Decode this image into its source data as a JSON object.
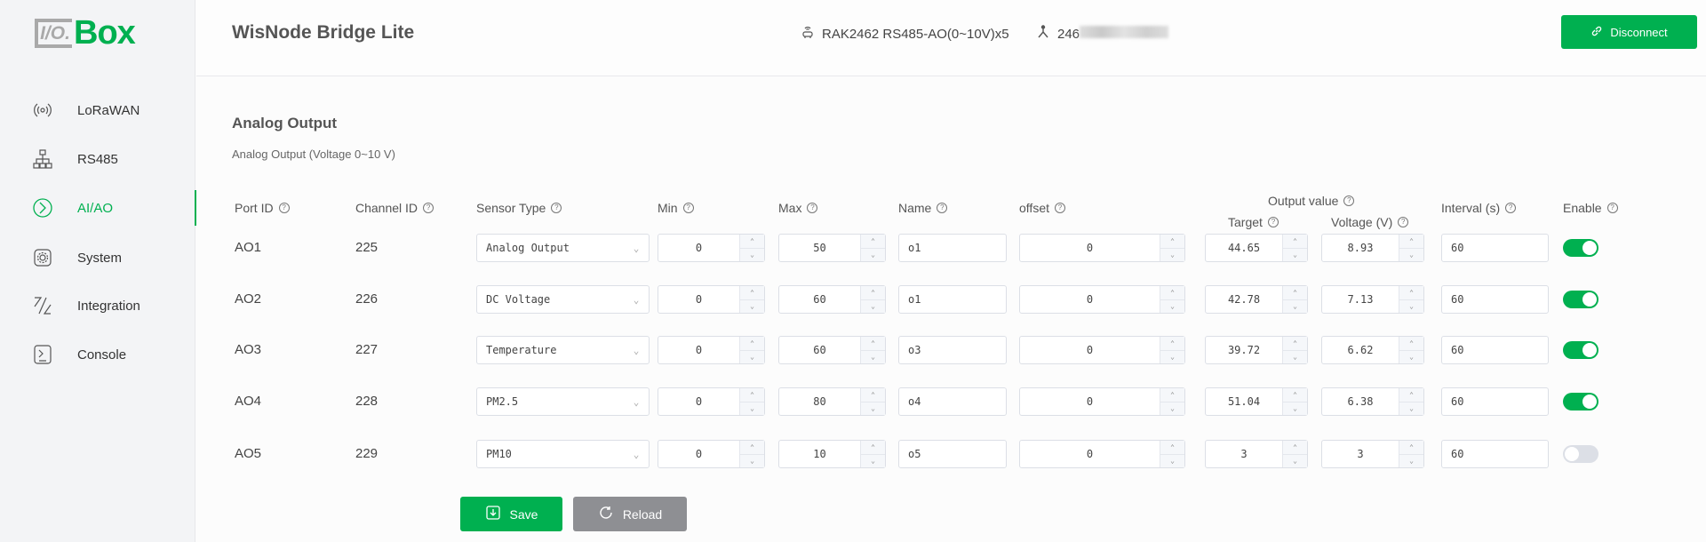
{
  "logo": {
    "io": "I/O.",
    "box": "Box"
  },
  "sidebar": {
    "items": [
      {
        "label": "LoRaWAN",
        "icon": "signal-icon"
      },
      {
        "label": "RS485",
        "icon": "network-icon"
      },
      {
        "label": "AI/AO",
        "icon": "aiao-icon",
        "active": true
      },
      {
        "label": "System",
        "icon": "gear-icon"
      },
      {
        "label": "Integration",
        "icon": "integration-icon"
      },
      {
        "label": "Console",
        "icon": "terminal-icon"
      }
    ]
  },
  "header": {
    "title": "WisNode Bridge Lite",
    "device": "RAK2462 RS485-AO(0~10V)x5",
    "serial_prefix": "246",
    "disconnect": "Disconnect"
  },
  "section": {
    "title": "Analog Output",
    "subtitle": "Analog Output (Voltage 0~10 V)"
  },
  "columns": {
    "port": "Port ID",
    "channel": "Channel ID",
    "sensor": "Sensor Type",
    "min": "Min",
    "max": "Max",
    "name": "Name",
    "offset": "offset",
    "output": "Output value",
    "target": "Target",
    "voltage": "Voltage (V)",
    "interval": "Interval (s)",
    "enable": "Enable"
  },
  "rows": [
    {
      "port": "AO1",
      "channel": "225",
      "sensor": "Analog Output",
      "min": "0",
      "max": "50",
      "name": "o1",
      "offset": "0",
      "target": "44.65",
      "voltage": "8.93",
      "interval": "60",
      "enabled": true
    },
    {
      "port": "AO2",
      "channel": "226",
      "sensor": "DC Voltage",
      "min": "0",
      "max": "60",
      "name": "o1",
      "offset": "0",
      "target": "42.78",
      "voltage": "7.13",
      "interval": "60",
      "enabled": true
    },
    {
      "port": "AO3",
      "channel": "227",
      "sensor": "Temperature",
      "min": "0",
      "max": "60",
      "name": "o3",
      "offset": "0",
      "target": "39.72",
      "voltage": "6.62",
      "interval": "60",
      "enabled": true
    },
    {
      "port": "AO4",
      "channel": "228",
      "sensor": "PM2.5",
      "min": "0",
      "max": "80",
      "name": "o4",
      "offset": "0",
      "target": "51.04",
      "voltage": "6.38",
      "interval": "60",
      "enabled": true
    },
    {
      "port": "AO5",
      "channel": "229",
      "sensor": "PM10",
      "min": "0",
      "max": "10",
      "name": "o5",
      "offset": "0",
      "target": "3",
      "voltage": "3",
      "interval": "60",
      "enabled": false
    }
  ],
  "actions": {
    "save": "Save",
    "reload": "Reload"
  },
  "colors": {
    "accent": "#00b050",
    "reload": "#8e8f93",
    "toggle_off": "#dcdfe6"
  }
}
